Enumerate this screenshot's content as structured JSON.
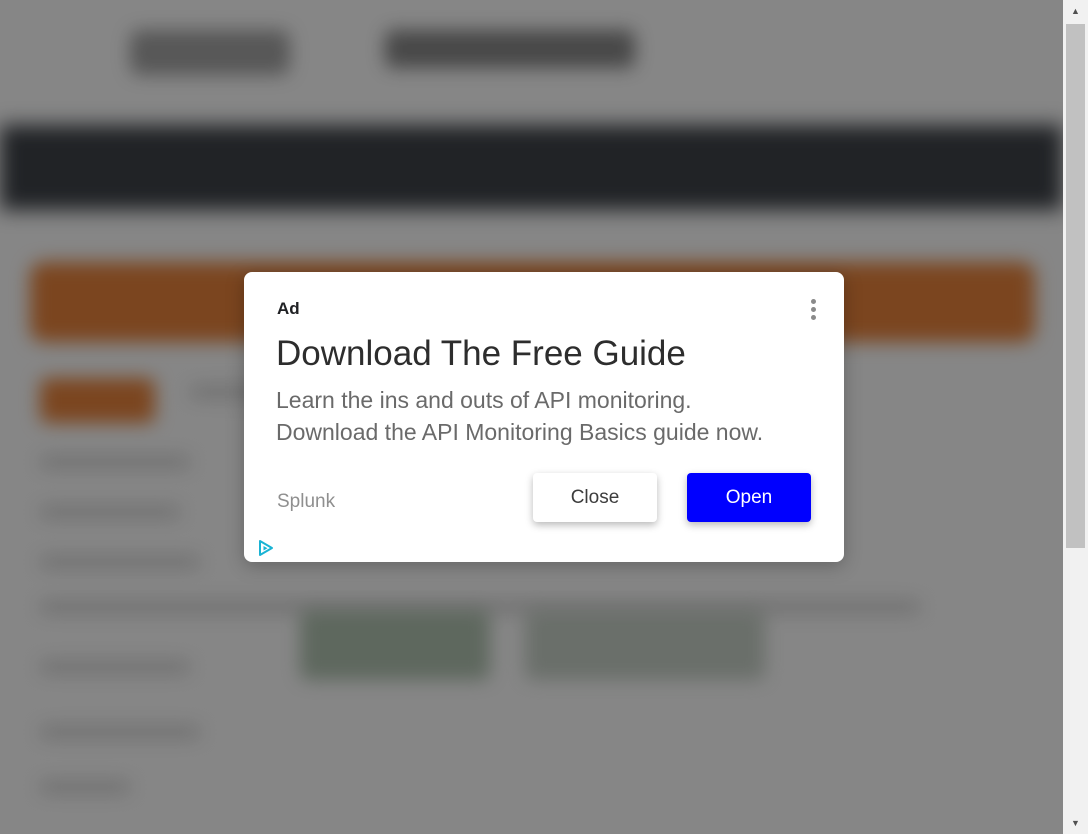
{
  "ad": {
    "label": "Ad",
    "headline": "Download The Free Guide",
    "body_line1": "Learn the ins and outs of API monitoring.",
    "body_line2": "Download the API Monitoring Basics guide now.",
    "advertiser": "Splunk",
    "close_label": "Close",
    "open_label": "Open",
    "menu_icon": "more-vert-icon",
    "adchoices_icon": "adchoices-icon"
  },
  "scrollbar": {
    "up_arrow": "▲",
    "down_arrow": "▼"
  },
  "colors": {
    "open_button": "#0000ff",
    "close_button": "#ffffff",
    "overlay": "rgba(0,0,0,0.45)",
    "adchoices": "#1ab3d4"
  }
}
